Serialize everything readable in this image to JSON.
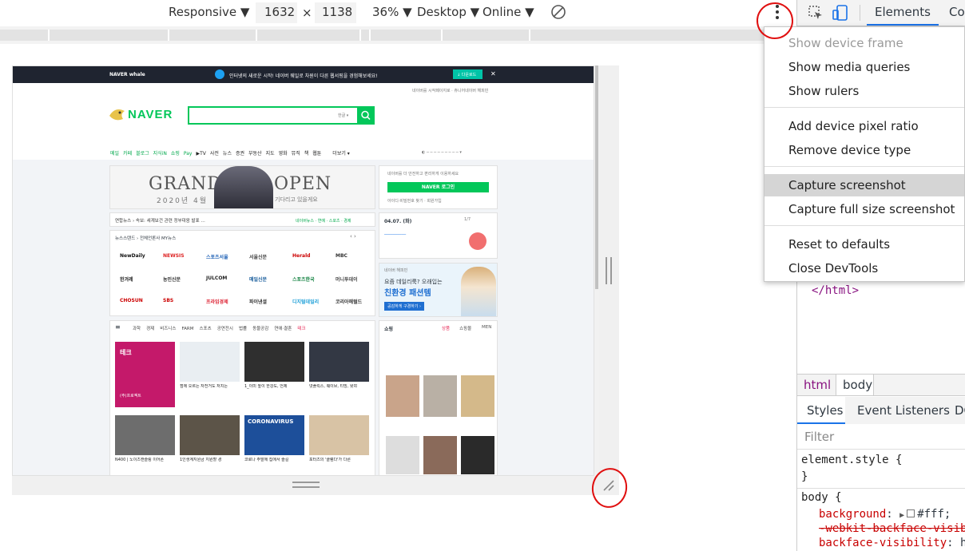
{
  "device_toolbar": {
    "mode": "Responsive",
    "width": "1632",
    "times": "×",
    "height": "1138",
    "zoom": "36%",
    "device_type": "Desktop",
    "throttle": "Online"
  },
  "devtools": {
    "tabs": [
      "Elements",
      "Cor"
    ],
    "doc_end": "</html>",
    "breadcrumbs": [
      "html",
      "body"
    ],
    "subtabs": [
      "Styles",
      "Event Listeners",
      "DO"
    ],
    "filter_placeholder": "Filter",
    "element_style": "element.style {",
    "element_style_close": "}",
    "body_selector": "body {",
    "props": [
      {
        "name": "background",
        "value": "#fff;"
      },
      {
        "name": "-webkit-backface-visibi",
        "value": ""
      },
      {
        "name": "backface-visibility",
        "value": "h"
      }
    ]
  },
  "menu": {
    "items": [
      {
        "label": "Show device frame",
        "state": "disabled"
      },
      {
        "label": "Show media queries",
        "state": "normal"
      },
      {
        "label": "Show rulers",
        "state": "normal"
      },
      {
        "label": "Add device pixel ratio",
        "state": "normal"
      },
      {
        "label": "Remove device type",
        "state": "normal"
      },
      {
        "label": "Capture screenshot",
        "state": "hover"
      },
      {
        "label": "Capture full size screenshot",
        "state": "normal"
      },
      {
        "label": "Reset to defaults",
        "state": "normal"
      },
      {
        "label": "Close DevTools",
        "state": "normal"
      }
    ]
  },
  "page": {
    "whale_brand": "NAVER whale",
    "whale_msg": "인터넷의 새로운 시작! 네이버 웨일로 차원이 다른 웹서핑을 경험해보세요!",
    "whale_btn": "↓ 다운로드",
    "top_links": "네이버를 시작페이지로 · 쥬니어네이버 해피빈",
    "logo": "NAVER",
    "search_kbd": "한글 ▾",
    "nav": [
      "메일",
      "카페",
      "블로그",
      "지식iN",
      "쇼핑",
      "Pay",
      "▶TV",
      "사전",
      "뉴스",
      "증권",
      "부동산",
      "지도",
      "영화",
      "뮤직",
      "책",
      "웹툰",
      "더보기 ▾"
    ],
    "banner_title_left": "GRAND",
    "banner_title_right": "OPEN",
    "banner_sub": "2020년 4월",
    "banner_sub2": "기다리고 있을게요",
    "login_info": "네이버를 더 안전하고 편리하게 이용하세요",
    "login_btn": "NAVER 로그인",
    "login_links": "아이디·비밀번호 찾기 · 회원가입",
    "news_bar": "연합뉴스 › 속보: 세계보건 관련 정부대응 발표 …",
    "news_bar_right": "네이버뉴스 · 연예 · 스포츠 · 경제",
    "date_row": "04.07. (화)",
    "date_page": "1/7",
    "newsstand": "뉴스스탠드 › 전체언론사   MY뉴스",
    "press_logos": [
      "NewDaily",
      "NEWSIS",
      "스포츠서울",
      "서울신문",
      "Herald",
      "MBC",
      "한겨레",
      "농민신문",
      "JULCOM",
      "매일신문",
      "스포츠한국",
      "머니투데이",
      "CHOSUN",
      "SBS",
      "프라임경제",
      "파이낸셜",
      "디지털데일리",
      "코리아헤럴드"
    ],
    "ad_label": "네이버 해피빈",
    "ad_headline": "요즘 데일리룩? 오래입는",
    "ad_big": "친환경 패션템",
    "ad_btn": "공감하게 구경하기 ›",
    "cat_tabs": [
      "과학",
      "경제",
      "비즈니스",
      "FARM",
      "스포츠",
      "공연전시",
      "법률",
      "동물공감",
      "연애·결혼",
      "테크"
    ],
    "shop_label": "쇼핑",
    "shop_tabs": [
      "상품",
      "쇼핑몰",
      "MEN"
    ],
    "tile_tag": "테크",
    "tile_tag_sub": "(주)프로젝트",
    "tiles": [
      "",
      "점에 오르는 자전거도 처치는",
      "1_이미 높이 한강도, 언제",
      "넷플릭스, 웨이브, 티빙, 왓챠",
      "N400 | 노이즈캔슬링 이어폰",
      "1인생계지원금 지원할 경",
      "코로나 주말에 집에서 즐길",
      "포터즈의 '클램다'가 다른"
    ],
    "corona_label": "CORONAVIRUS"
  }
}
